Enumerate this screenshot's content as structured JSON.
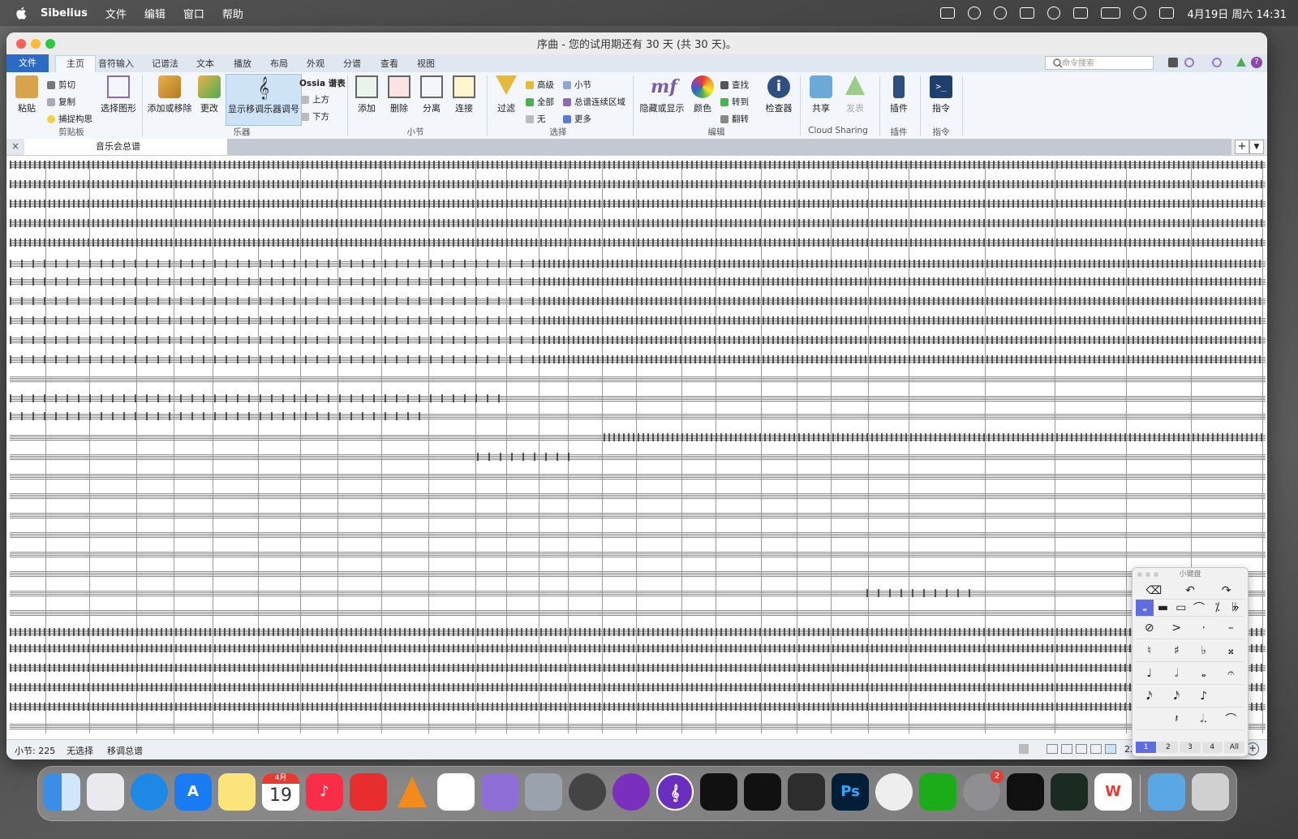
{
  "menubar": {
    "app": "Sibelius",
    "items": [
      "文件",
      "编辑",
      "窗口",
      "帮助"
    ],
    "clock": "4月19日 周六  14:31"
  },
  "window": {
    "title": "序曲 - 您的试用期还有 30 天 (共 30 天)。"
  },
  "ribbon_tabs": [
    "文件",
    "主页",
    "音符输入",
    "记谱法",
    "文本",
    "播放",
    "布局",
    "外观",
    "分谱",
    "查看",
    "视图"
  ],
  "command_search": {
    "placeholder": "命令搜索"
  },
  "ribbon": {
    "clipboard": {
      "paste": "粘贴",
      "cut": "剪切",
      "copy": "复制",
      "capture": "捕捉构思",
      "select_graphic": "选择图形",
      "group": "剪贴板"
    },
    "instruments": {
      "add_remove": "添加或移除",
      "change": "更改",
      "show_transposing": "显示移调乐器调号",
      "ossia": "Ossia 谱表",
      "above": "上方",
      "below": "下方",
      "group": "乐器"
    },
    "bars": {
      "add": "添加",
      "delete": "删除",
      "split": "分离",
      "join": "连接",
      "group": "小节"
    },
    "selection": {
      "filter": "过滤",
      "advanced": "高级",
      "all": "全部",
      "none": "无",
      "bar": "小节",
      "system_passage": "总谱连续区域",
      "more": "更多",
      "group": "选择"
    },
    "edit": {
      "hide_show": "隐藏或显示",
      "color": "颜色",
      "find": "查找",
      "goto": "转到",
      "flip": "翻转",
      "inspector": "检查器",
      "group": "编辑"
    },
    "cloud": {
      "share": "共享",
      "publish": "发表",
      "group": "Cloud Sharing"
    },
    "plugins": {
      "label": "插件",
      "group": "插件"
    },
    "commands": {
      "label": "指令",
      "group": "指令"
    }
  },
  "doc_tab": {
    "label": "音乐会总谱"
  },
  "statusbar": {
    "bar": "小节: 225",
    "selection": "无选择",
    "transpose": "移调总谱",
    "zoom": "22"
  },
  "keypad": {
    "title": "小键盘",
    "rows": [
      [
        "⌫",
        "↶",
        "↷"
      ],
      [
        "𝅝",
        "▬",
        "▭",
        "⌒",
        "⁒",
        "𝄫"
      ],
      [
        "⊘",
        ">",
        "·",
        "–"
      ],
      [
        "♮",
        "♯",
        "♭",
        "𝄪"
      ],
      [
        "♩",
        "𝅗𝅥",
        "𝅝",
        "𝄐"
      ],
      [
        "𝅘𝅥𝅯",
        "𝅘𝅥𝅯",
        "♪",
        ""
      ],
      [
        "",
        "𝄽",
        "𝅗𝅥.",
        "⌒"
      ]
    ],
    "layouts": [
      "1",
      "2",
      "3",
      "4",
      "All"
    ]
  },
  "dock": {
    "calendar_month": "4月",
    "calendar_day": "19",
    "settings_badge": "2",
    "ps_label": "Ps"
  }
}
